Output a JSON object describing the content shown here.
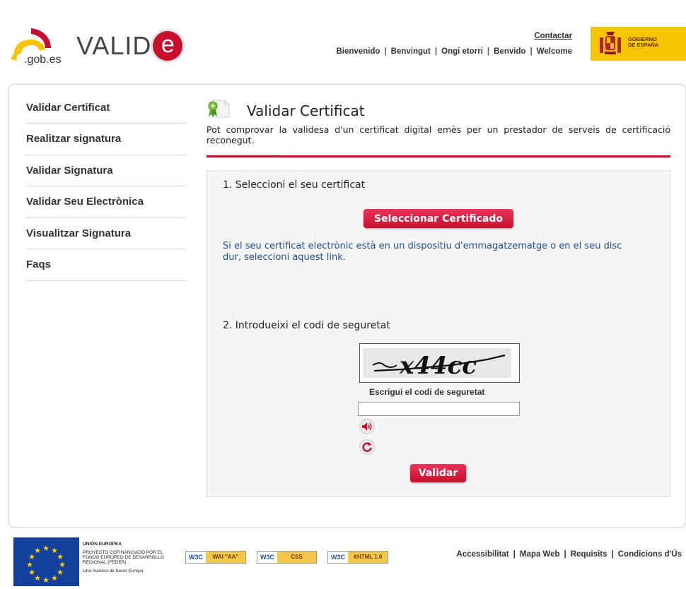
{
  "header": {
    "gob_logo_text": ".gob.es",
    "valide_logo_text": "VALID",
    "valide_logo_e": "e",
    "contact_label": "Contactar",
    "languages": [
      "Bienvenido",
      "Benvingut",
      "Ongi etorri",
      "Benvido",
      "Welcome"
    ],
    "separator": "|",
    "gov_logo_text": [
      "GOBIERNO",
      "DE ESPAÑA"
    ]
  },
  "sidebar": {
    "items": [
      {
        "label": "Validar Certificat"
      },
      {
        "label": "Realitzar signatura"
      },
      {
        "label": "Validar Signatura"
      },
      {
        "label": "Validar Seu Electrònica"
      },
      {
        "label": "Visualitzar Signatura"
      },
      {
        "label": "Faqs"
      }
    ]
  },
  "main": {
    "title": "Validar Certificat",
    "description": "Pot comprovar la validesa d'un certificat digital emès per un prestador de serveis de certificació reconegut.",
    "step1_label": "1. Seleccioni el seu certificat",
    "select_button_label": "Seleccionar Certificado",
    "cert_link_text": "Si el seu certificat electrònic està en un dispositiu d'emmagatzematge o en el seu disc dur, seleccioni aquest link.",
    "step2_label": "2. Introdueixi el codi de seguretat",
    "captcha_text": "x44cc",
    "captcha_label": "Escrigui el codi de seguretat",
    "captcha_input_value": "",
    "validate_button_label": "Validar"
  },
  "footer": {
    "eu_heading": "UNIÓN EUROPEA",
    "eu_project": "PROYECTO COFINANCIADO POR EL FONDO EUROPEO DE DESARROLLO REGIONAL (FEDER)",
    "eu_slogan": "Una manera de hacer Europa",
    "badges": [
      {
        "w3c": "W3C",
        "label": "WAI \"AA\""
      },
      {
        "w3c": "W3C",
        "label": "CSS"
      },
      {
        "w3c": "W3C",
        "label": "XHTML 1.0"
      }
    ],
    "links": [
      "Accessibilitat",
      "Mapa Web",
      "Requisits",
      "Condicions d'Ús"
    ]
  },
  "colors": {
    "accent": "#c8102e",
    "link": "#1f4f8f",
    "gov_yellow": "#f6c400",
    "eu_blue": "#12409a"
  }
}
